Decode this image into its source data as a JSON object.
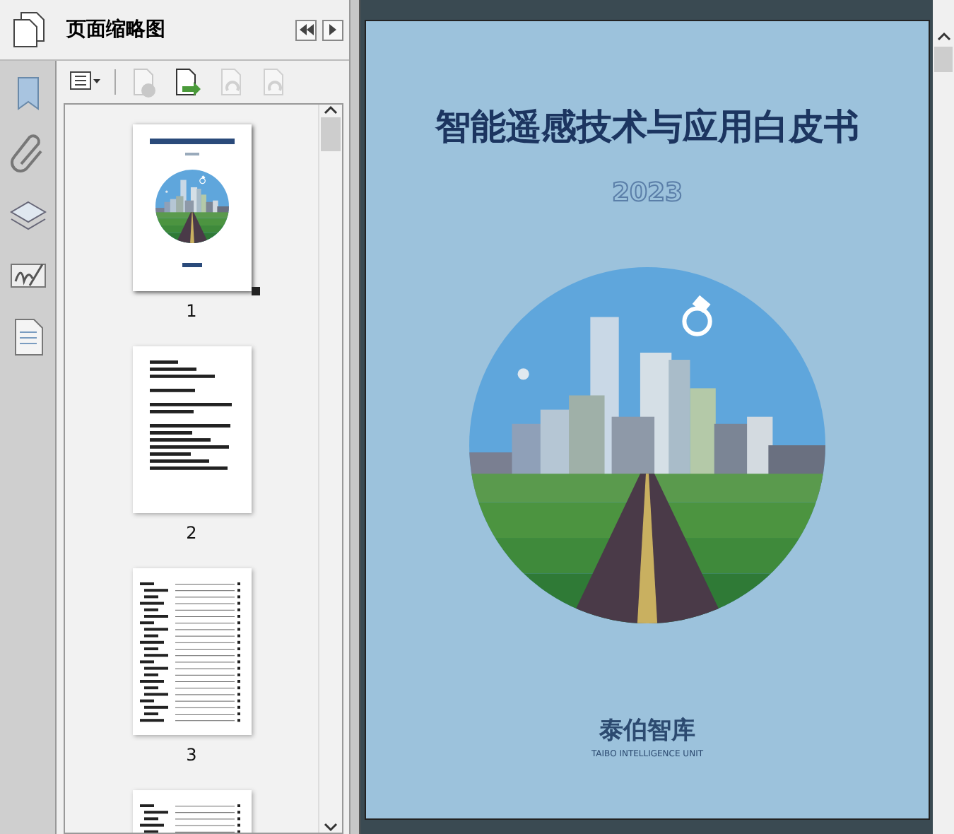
{
  "side_panel": {
    "title": "页面缩略图",
    "rail_icons": [
      {
        "kind": "bookmark"
      },
      {
        "kind": "attachment"
      },
      {
        "kind": "layers"
      },
      {
        "kind": "signature"
      },
      {
        "kind": "page"
      }
    ],
    "toolbar": [
      {
        "kind": "options",
        "disabled": false
      },
      {
        "kind": "delete",
        "disabled": true
      },
      {
        "kind": "insert",
        "disabled": false
      },
      {
        "kind": "undo",
        "disabled": true
      },
      {
        "kind": "redo",
        "disabled": true
      }
    ],
    "thumbnails": [
      {
        "label": "1",
        "kind": "cover",
        "selected": true
      },
      {
        "label": "2",
        "kind": "text",
        "selected": false
      },
      {
        "label": "3",
        "kind": "toc",
        "selected": false
      },
      {
        "kind": "toc",
        "selected": false
      }
    ]
  },
  "document": {
    "title": "智能遥感技术与应用白皮书",
    "year": "2023",
    "publisher": "泰伯智库",
    "publisher_en": "TAIBO INTELLIGENCE UNIT"
  }
}
